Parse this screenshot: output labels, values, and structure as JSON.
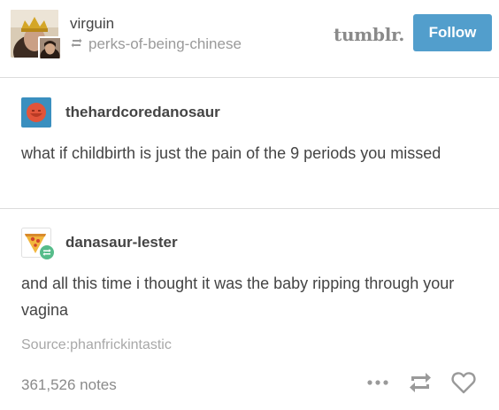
{
  "header": {
    "poster": "virguin",
    "reblogged_from": "perks-of-being-chinese",
    "logo": "tumblr.",
    "follow_label": "Follow",
    "colors": {
      "follow_button": "#529ecc",
      "reblog_badge": "#56bc8a"
    }
  },
  "posts": [
    {
      "username": "thehardcoredanosaur",
      "text": "what if childbirth is just the pain of the 9 periods you missed"
    },
    {
      "username": "danasaur-lester",
      "text": "and all this time i thought it was the baby ripping through your vagina",
      "source": "Source:phanfrickintastic",
      "notes": "361,526 notes",
      "actions": [
        "more-icon",
        "reblog-icon",
        "like-icon"
      ]
    }
  ]
}
